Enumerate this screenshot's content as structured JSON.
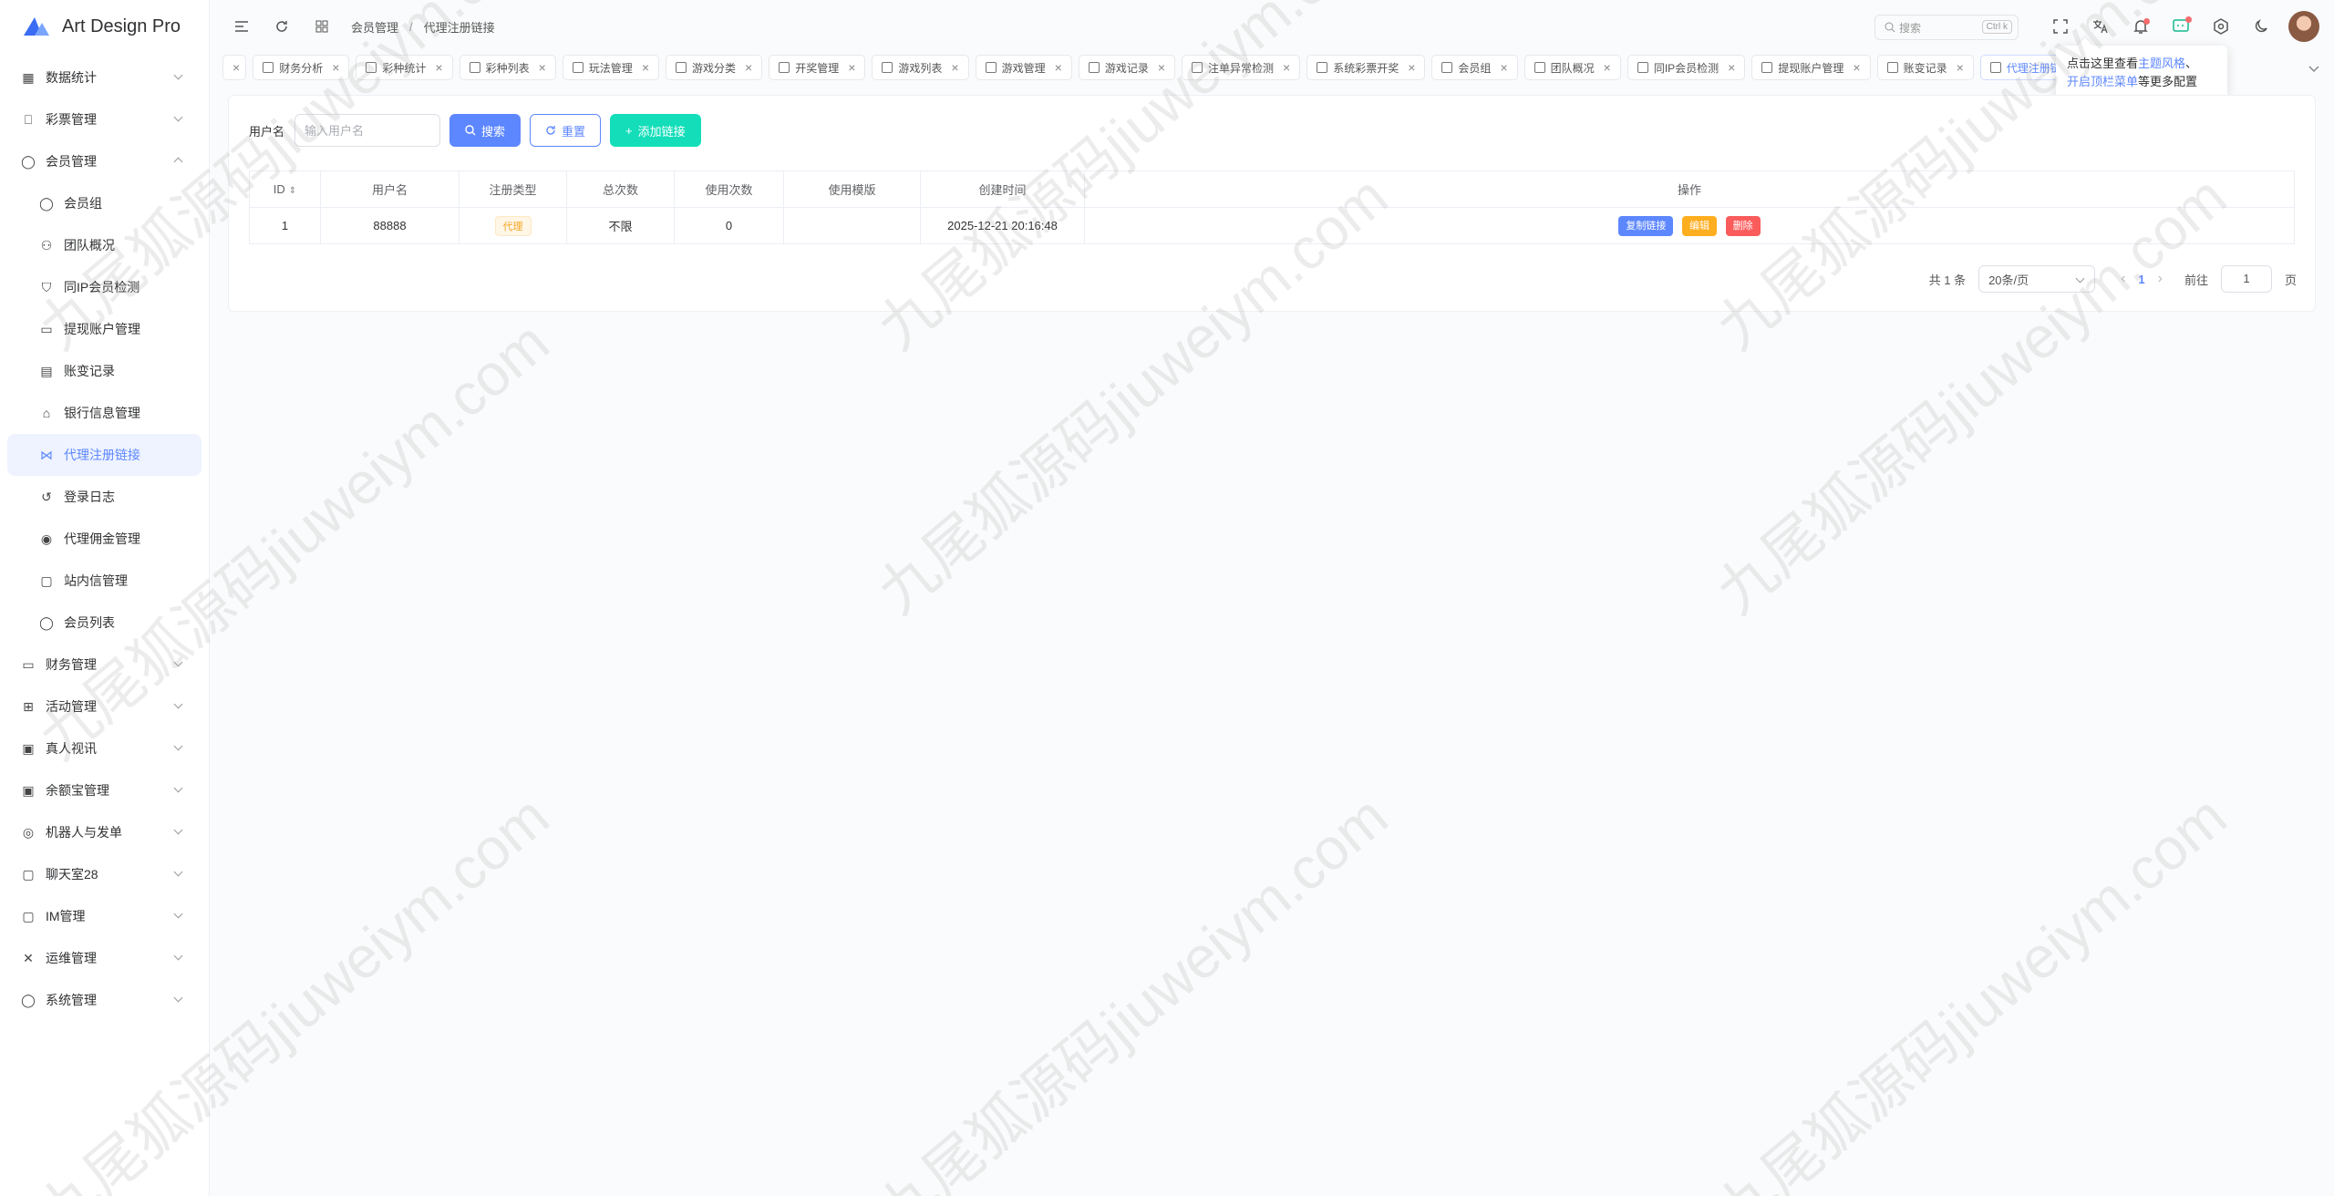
{
  "app": {
    "title": "Art Design Pro"
  },
  "sidebar": {
    "groups": [
      {
        "label": "数据统计",
        "icon": "chart-icon",
        "expanded": false
      },
      {
        "label": "彩票管理",
        "icon": "ticket-icon",
        "expanded": false
      },
      {
        "label": "会员管理",
        "icon": "user-icon",
        "expanded": true
      }
    ],
    "sub_items": [
      {
        "label": "会员组",
        "icon": "users-icon"
      },
      {
        "label": "团队概况",
        "icon": "team-icon"
      },
      {
        "label": "同IP会员检测",
        "icon": "shield-icon"
      },
      {
        "label": "提现账户管理",
        "icon": "card-icon"
      },
      {
        "label": "账变记录",
        "icon": "document-icon"
      },
      {
        "label": "银行信息管理",
        "icon": "bank-icon"
      },
      {
        "label": "代理注册链接",
        "icon": "share-icon",
        "active": true
      },
      {
        "label": "登录日志",
        "icon": "history-icon"
      },
      {
        "label": "代理佣金管理",
        "icon": "coin-icon"
      },
      {
        "label": "站内信管理",
        "icon": "message-icon"
      },
      {
        "label": "会员列表",
        "icon": "user-list-icon"
      }
    ],
    "bottom_groups": [
      {
        "label": "财务管理",
        "icon": "wallet-icon"
      },
      {
        "label": "活动管理",
        "icon": "gift-icon"
      },
      {
        "label": "真人视讯",
        "icon": "video-icon"
      },
      {
        "label": "余额宝管理",
        "icon": "safe-icon"
      },
      {
        "label": "机器人与发单",
        "icon": "robot-icon"
      },
      {
        "label": "聊天室28",
        "icon": "chat-icon"
      },
      {
        "label": "IM管理",
        "icon": "im-icon"
      },
      {
        "label": "运维管理",
        "icon": "tools-icon"
      },
      {
        "label": "系统管理",
        "icon": "settings-user-icon"
      }
    ]
  },
  "header": {
    "breadcrumb": [
      "会员管理",
      "代理注册链接"
    ],
    "breadcrumb_sep": "/",
    "search_placeholder": "搜索",
    "search_shortcut": "Ctrl k"
  },
  "tabs": [
    {
      "label": "财务分析"
    },
    {
      "label": "彩种统计"
    },
    {
      "label": "彩种列表"
    },
    {
      "label": "玩法管理"
    },
    {
      "label": "游戏分类"
    },
    {
      "label": "开奖管理"
    },
    {
      "label": "游戏列表"
    },
    {
      "label": "游戏管理"
    },
    {
      "label": "游戏记录"
    },
    {
      "label": "注单异常检测"
    },
    {
      "label": "系统彩票开奖"
    },
    {
      "label": "会员组"
    },
    {
      "label": "团队概况"
    },
    {
      "label": "同IP会员检测"
    },
    {
      "label": "提现账户管理"
    },
    {
      "label": "账变记录"
    },
    {
      "label": "代理注册链接",
      "active": true
    }
  ],
  "tooltip": {
    "line1_prefix": "点击这里查看",
    "line1_link": "主题风格",
    "line1_suffix": "、",
    "line2_link": "开启顶栏菜单",
    "line2_suffix": "等更多配置"
  },
  "filter": {
    "label": "用户名",
    "placeholder": "输入用户名",
    "search_button": "搜索",
    "reset_button": "重置",
    "add_button": "添加链接"
  },
  "table": {
    "columns": [
      "ID",
      "用户名",
      "注册类型",
      "总次数",
      "使用次数",
      "使用模版",
      "创建时间",
      "操作"
    ],
    "rows": [
      {
        "id": "1",
        "username": "88888",
        "type": "代理",
        "total": "不限",
        "used": "0",
        "template": "",
        "created": "2025-12-21 20:16:48"
      }
    ],
    "actions": {
      "copy": "复制链接",
      "edit": "编辑",
      "delete": "删除"
    }
  },
  "pagination": {
    "total": "共 1 条",
    "page_size": "20条/页",
    "current_page": "1",
    "goto_label": "前往",
    "goto_value": "1",
    "page_suffix": "页"
  },
  "watermark": "九尾狐源码jiuweiym.com",
  "colors": {
    "primary": "#5d87ff",
    "success": "#13deb9",
    "warning": "#ffae1f",
    "danger": "#fa5c5c"
  }
}
